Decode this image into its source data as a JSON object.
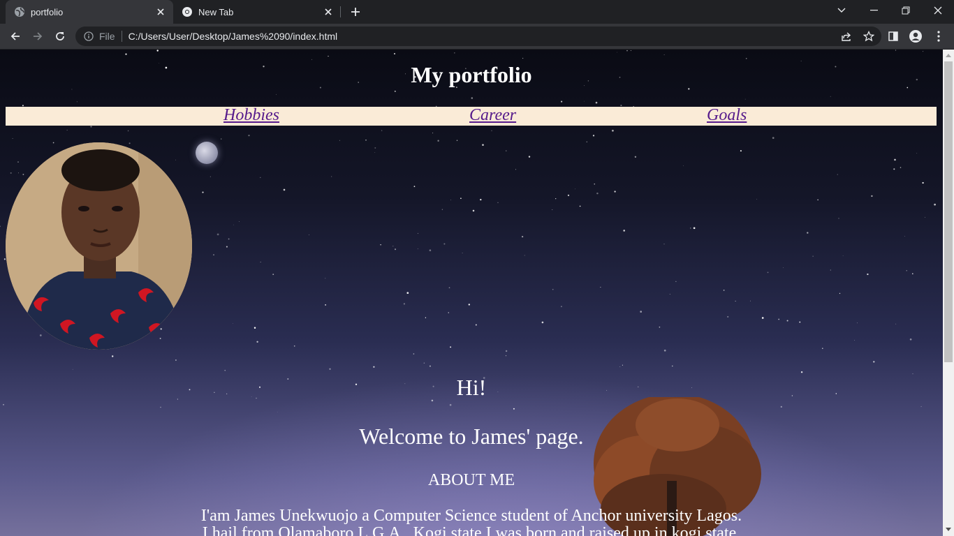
{
  "browser": {
    "tabs": [
      {
        "title": "portfolio",
        "icon": "globe-icon",
        "active": true
      },
      {
        "title": "New Tab",
        "icon": "chrome-icon",
        "active": false
      }
    ],
    "address": {
      "scheme": "File",
      "url": "C:/Users/User/Desktop/James%2090/index.html"
    }
  },
  "page": {
    "title": "My portfolio",
    "nav": [
      {
        "label": "Hobbies"
      },
      {
        "label": "Career"
      },
      {
        "label": "Goals"
      }
    ],
    "greeting": "Hi!",
    "welcome": "Welcome to James' page.",
    "about_heading": "ABOUT ME",
    "bio_line_1": "I'am James Unekwuojo a Computer Science student of Anchor university Lagos.",
    "bio_line_2": "I hail from Olamaboro L.G.A., Kogi state.I was born and raised up in kogi state."
  },
  "colors": {
    "nav_background": "#faebd7",
    "link": "#551a8b",
    "chrome_dark": "#202124",
    "chrome_toolbar": "#35363a"
  }
}
